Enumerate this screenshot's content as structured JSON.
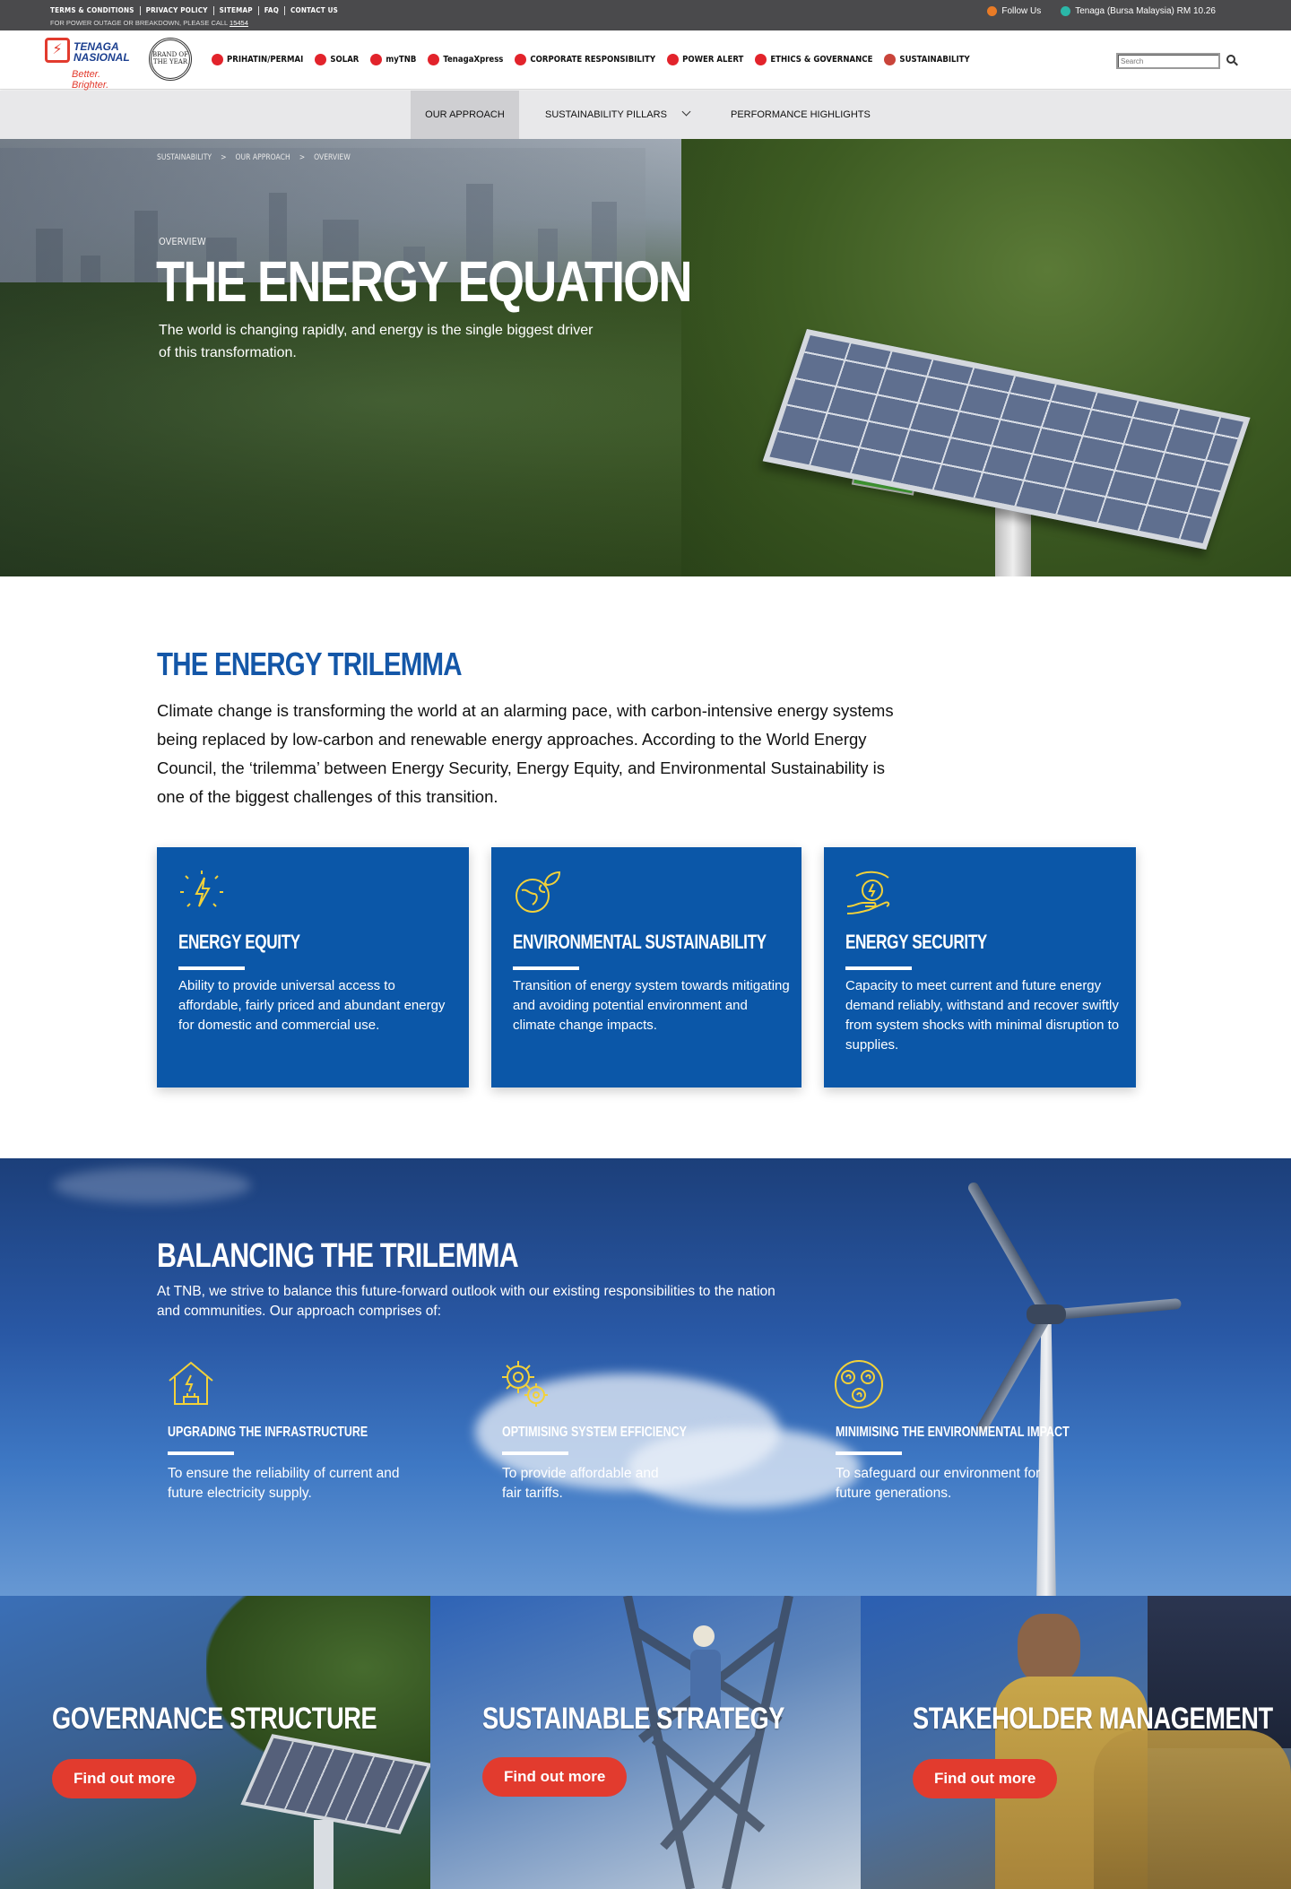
{
  "utility": {
    "links": [
      "TERMS & CONDITIONS",
      "PRIVACY POLICY",
      "SITEMAP",
      "FAQ",
      "CONTACT US"
    ],
    "note": "FOR POWER OUTAGE OR BREAKDOWN, PLEASE CALL",
    "hotline": "15454",
    "follow": "Follow Us",
    "stock": "Tenaga (Bursa Malaysia) RM 10.26"
  },
  "header": {
    "logo_top": "TENAGA",
    "logo_bottom": "NASIONAL",
    "logo_tagline": "Better. Brighter.",
    "badge": "BRAND OF THE YEAR",
    "nav": [
      "PRIHATIN/PERMAI",
      "SOLAR",
      "myTNB",
      "TenagaXpress",
      "CORPORATE RESPONSIBILITY",
      "POWER ALERT",
      "ETHICS & GOVERNANCE",
      "SUSTAINABILITY"
    ],
    "search_placeholder": "Search"
  },
  "subnav": {
    "tabs": [
      "OUR APPROACH",
      "SUSTAINABILITY PILLARS",
      "PERFORMANCE HIGHLIGHTS"
    ]
  },
  "hero": {
    "breadcrumb": [
      "SUSTAINABILITY",
      ">",
      "OUR APPROACH",
      ">",
      "OVERVIEW"
    ],
    "eyebrow": "OVERVIEW",
    "title": "THE ENERGY EQUATION",
    "subtitle": "The world is changing rapidly, and energy is the single biggest driver of this transformation."
  },
  "trilemma": {
    "title": "THE ENERGY TRILEMMA",
    "body": "Climate change is transforming the world at an alarming pace, with carbon-intensive energy systems being replaced by low-carbon and renewable energy approaches. According to the World Energy Council, the ‘trilemma’ between Energy Security, Energy Equity, and Environmental Sustainability is one of the biggest challenges of this transition.",
    "cards": [
      {
        "title": "ENERGY EQUITY",
        "text": "Ability to provide universal access to affordable, fairly priced and abundant energy for domestic and commercial use.",
        "icon": "lightning-bulb-icon"
      },
      {
        "title": "ENVIRONMENTAL SUSTAINABILITY",
        "text": "Transition of energy system towards mitigating and avoiding potential environment and climate change impacts.",
        "icon": "globe-leaf-icon"
      },
      {
        "title": "ENERGY SECURITY",
        "text": "Capacity to meet current and future energy demand reliably, withstand and recover swiftly from system shocks with minimal disruption to supplies.",
        "icon": "hand-energy-icon"
      }
    ]
  },
  "balancing": {
    "title": "BALANCING THE TRILEMMA",
    "body": "At TNB, we strive to balance this future-forward outlook with our existing responsibilities to the nation and communities. Our approach comprises of:",
    "pillars": [
      {
        "title": "UPGRADING THE INFRASTRUCTURE",
        "text": "To ensure the reliability of current and future electricity supply.",
        "icon": "house-plug-icon"
      },
      {
        "title": "OPTIMISING SYSTEM EFFICIENCY",
        "text": "To provide affordable and fair tariffs.",
        "icon": "gears-icon"
      },
      {
        "title": "MINIMISING THE ENVIRONMENTAL IMPACT",
        "text": "To safeguard our environment for future generations.",
        "icon": "eco-circle-icon"
      }
    ]
  },
  "tiles": [
    {
      "title": "GOVERNANCE STRUCTURE",
      "button": "Find out more"
    },
    {
      "title": "SUSTAINABLE STRATEGY",
      "button": "Find out more"
    },
    {
      "title": "STAKEHOLDER MANAGEMENT",
      "button": "Find out more"
    }
  ],
  "colors": {
    "brand_blue": "#0b57a8",
    "brand_red": "#e23b2e",
    "icon_yellow": "#f2d13a"
  }
}
